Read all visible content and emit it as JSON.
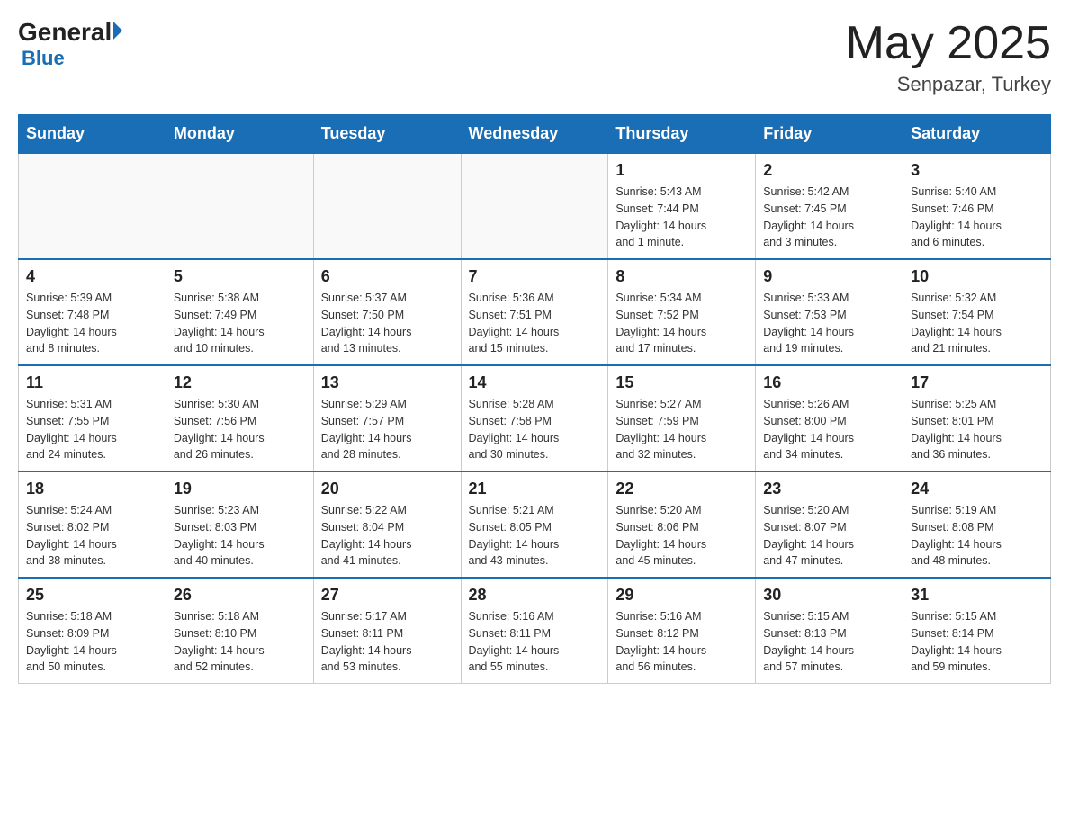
{
  "header": {
    "logo_general": "General",
    "logo_blue": "Blue",
    "month_year": "May 2025",
    "location": "Senpazar, Turkey"
  },
  "days_of_week": [
    "Sunday",
    "Monday",
    "Tuesday",
    "Wednesday",
    "Thursday",
    "Friday",
    "Saturday"
  ],
  "weeks": [
    [
      {
        "day": "",
        "info": ""
      },
      {
        "day": "",
        "info": ""
      },
      {
        "day": "",
        "info": ""
      },
      {
        "day": "",
        "info": ""
      },
      {
        "day": "1",
        "info": "Sunrise: 5:43 AM\nSunset: 7:44 PM\nDaylight: 14 hours\nand 1 minute."
      },
      {
        "day": "2",
        "info": "Sunrise: 5:42 AM\nSunset: 7:45 PM\nDaylight: 14 hours\nand 3 minutes."
      },
      {
        "day": "3",
        "info": "Sunrise: 5:40 AM\nSunset: 7:46 PM\nDaylight: 14 hours\nand 6 minutes."
      }
    ],
    [
      {
        "day": "4",
        "info": "Sunrise: 5:39 AM\nSunset: 7:48 PM\nDaylight: 14 hours\nand 8 minutes."
      },
      {
        "day": "5",
        "info": "Sunrise: 5:38 AM\nSunset: 7:49 PM\nDaylight: 14 hours\nand 10 minutes."
      },
      {
        "day": "6",
        "info": "Sunrise: 5:37 AM\nSunset: 7:50 PM\nDaylight: 14 hours\nand 13 minutes."
      },
      {
        "day": "7",
        "info": "Sunrise: 5:36 AM\nSunset: 7:51 PM\nDaylight: 14 hours\nand 15 minutes."
      },
      {
        "day": "8",
        "info": "Sunrise: 5:34 AM\nSunset: 7:52 PM\nDaylight: 14 hours\nand 17 minutes."
      },
      {
        "day": "9",
        "info": "Sunrise: 5:33 AM\nSunset: 7:53 PM\nDaylight: 14 hours\nand 19 minutes."
      },
      {
        "day": "10",
        "info": "Sunrise: 5:32 AM\nSunset: 7:54 PM\nDaylight: 14 hours\nand 21 minutes."
      }
    ],
    [
      {
        "day": "11",
        "info": "Sunrise: 5:31 AM\nSunset: 7:55 PM\nDaylight: 14 hours\nand 24 minutes."
      },
      {
        "day": "12",
        "info": "Sunrise: 5:30 AM\nSunset: 7:56 PM\nDaylight: 14 hours\nand 26 minutes."
      },
      {
        "day": "13",
        "info": "Sunrise: 5:29 AM\nSunset: 7:57 PM\nDaylight: 14 hours\nand 28 minutes."
      },
      {
        "day": "14",
        "info": "Sunrise: 5:28 AM\nSunset: 7:58 PM\nDaylight: 14 hours\nand 30 minutes."
      },
      {
        "day": "15",
        "info": "Sunrise: 5:27 AM\nSunset: 7:59 PM\nDaylight: 14 hours\nand 32 minutes."
      },
      {
        "day": "16",
        "info": "Sunrise: 5:26 AM\nSunset: 8:00 PM\nDaylight: 14 hours\nand 34 minutes."
      },
      {
        "day": "17",
        "info": "Sunrise: 5:25 AM\nSunset: 8:01 PM\nDaylight: 14 hours\nand 36 minutes."
      }
    ],
    [
      {
        "day": "18",
        "info": "Sunrise: 5:24 AM\nSunset: 8:02 PM\nDaylight: 14 hours\nand 38 minutes."
      },
      {
        "day": "19",
        "info": "Sunrise: 5:23 AM\nSunset: 8:03 PM\nDaylight: 14 hours\nand 40 minutes."
      },
      {
        "day": "20",
        "info": "Sunrise: 5:22 AM\nSunset: 8:04 PM\nDaylight: 14 hours\nand 41 minutes."
      },
      {
        "day": "21",
        "info": "Sunrise: 5:21 AM\nSunset: 8:05 PM\nDaylight: 14 hours\nand 43 minutes."
      },
      {
        "day": "22",
        "info": "Sunrise: 5:20 AM\nSunset: 8:06 PM\nDaylight: 14 hours\nand 45 minutes."
      },
      {
        "day": "23",
        "info": "Sunrise: 5:20 AM\nSunset: 8:07 PM\nDaylight: 14 hours\nand 47 minutes."
      },
      {
        "day": "24",
        "info": "Sunrise: 5:19 AM\nSunset: 8:08 PM\nDaylight: 14 hours\nand 48 minutes."
      }
    ],
    [
      {
        "day": "25",
        "info": "Sunrise: 5:18 AM\nSunset: 8:09 PM\nDaylight: 14 hours\nand 50 minutes."
      },
      {
        "day": "26",
        "info": "Sunrise: 5:18 AM\nSunset: 8:10 PM\nDaylight: 14 hours\nand 52 minutes."
      },
      {
        "day": "27",
        "info": "Sunrise: 5:17 AM\nSunset: 8:11 PM\nDaylight: 14 hours\nand 53 minutes."
      },
      {
        "day": "28",
        "info": "Sunrise: 5:16 AM\nSunset: 8:11 PM\nDaylight: 14 hours\nand 55 minutes."
      },
      {
        "day": "29",
        "info": "Sunrise: 5:16 AM\nSunset: 8:12 PM\nDaylight: 14 hours\nand 56 minutes."
      },
      {
        "day": "30",
        "info": "Sunrise: 5:15 AM\nSunset: 8:13 PM\nDaylight: 14 hours\nand 57 minutes."
      },
      {
        "day": "31",
        "info": "Sunrise: 5:15 AM\nSunset: 8:14 PM\nDaylight: 14 hours\nand 59 minutes."
      }
    ]
  ]
}
